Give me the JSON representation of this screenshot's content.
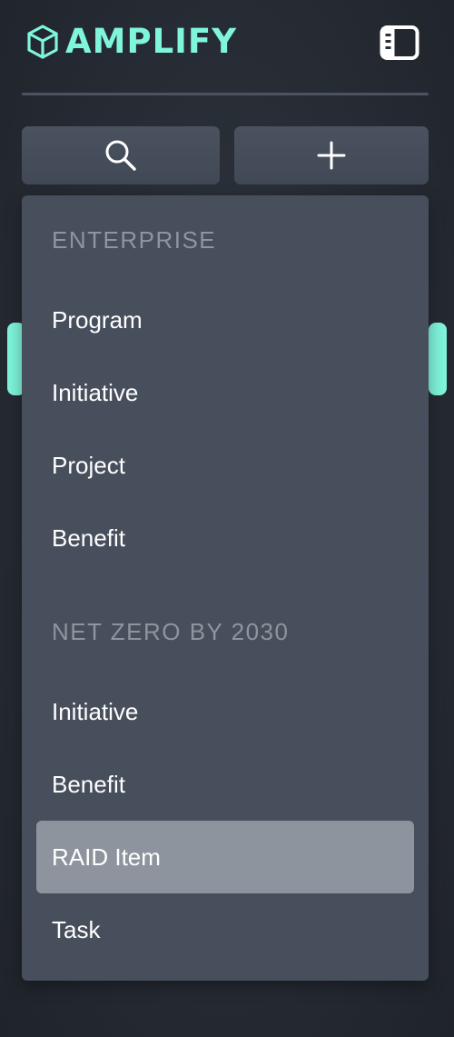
{
  "brand": {
    "name": "AMPLIFY",
    "accent_color": "#7ff5dc",
    "logo_icon": "cube-icon"
  },
  "header": {
    "toggle_icon": "sidebar-toggle-icon"
  },
  "actions": {
    "search_icon": "search-icon",
    "add_icon": "plus-icon"
  },
  "menu": {
    "sections": [
      {
        "title": "ENTERPRISE",
        "items": [
          "Program",
          "Initiative",
          "Project",
          "Benefit"
        ]
      },
      {
        "title": "NET ZERO BY 2030",
        "items": [
          "Initiative",
          "Benefit",
          "RAID Item",
          "Task"
        ]
      }
    ],
    "active_item": "RAID Item",
    "colors": {
      "menu_background": "#474f5d",
      "active_background": "#8e949d",
      "section_header": "#8f959e"
    }
  }
}
